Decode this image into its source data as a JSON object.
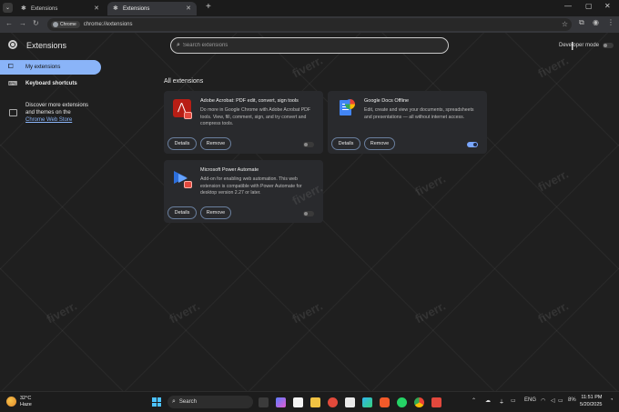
{
  "browser": {
    "tabs": [
      {
        "label": "Extensions",
        "active": false
      },
      {
        "label": "Extensions",
        "active": true
      }
    ],
    "chip_label": "Chrome",
    "url": "chrome://extensions"
  },
  "header": {
    "title": "Extensions",
    "search_placeholder": "Search extensions",
    "dev_mode_label": "Developer mode",
    "dev_mode_on": false
  },
  "sidebar": {
    "items": [
      {
        "label": "My extensions",
        "icon": "puzzle-icon",
        "active": true
      },
      {
        "label": "Keyboard shortcuts",
        "icon": "keyboard-icon",
        "active": false
      }
    ],
    "discover_text": "Discover more extensions and themes on the",
    "store_link": "Chrome Web Store"
  },
  "main": {
    "section_title": "All extensions",
    "details_label": "Details",
    "remove_label": "Remove",
    "extensions": [
      {
        "name": "Adobe Acrobat: PDF edit, convert, sign tools",
        "description": "Do more in Google Chrome with Adobe Acrobat PDF tools. View, fill, comment, sign, and try convert and compress tools.",
        "enabled": false,
        "icon": "acrobat-icon"
      },
      {
        "name": "Google Docs Offline",
        "description": "Edit, create and view your documents, spreadsheets and presentations — all without internet access.",
        "enabled": true,
        "icon": "google-docs-icon"
      },
      {
        "name": "Microsoft Power Automate",
        "description": "Add-on for enabling web automation. This web extension is compatible with Power Automate for desktop version 2.27 or later.",
        "enabled": false,
        "icon": "power-automate-icon"
      }
    ]
  },
  "watermark": "fiverr.",
  "taskbar": {
    "temperature": "32°C",
    "weather": "Haze",
    "search_label": "Search",
    "language": "ENG",
    "battery": "8%",
    "time": "11:51 PM",
    "date": "5/20/2025"
  },
  "colors": {
    "accent": "#8ab4f8",
    "background": "#1f1f1f",
    "card": "#292a2d"
  }
}
